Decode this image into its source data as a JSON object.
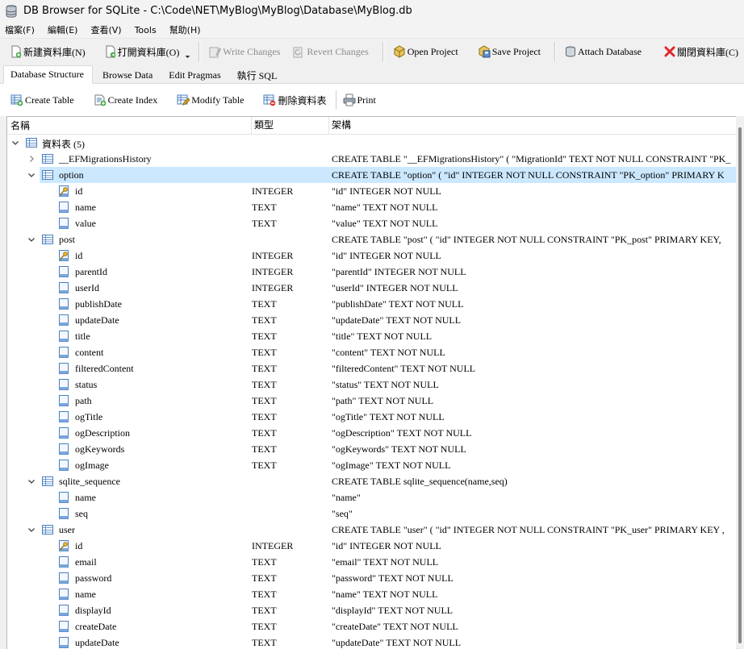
{
  "window": {
    "title": "DB Browser for SQLite - C:\\Code\\NET\\MyBlog\\MyBlog\\Database\\MyBlog.db",
    "icon": "database-app-icon"
  },
  "menu": [
    "檔案(F)",
    "編輯(E)",
    "查看(V)",
    "Tools",
    "幫助(H)"
  ],
  "toolbar": {
    "new_db": "新建資料庫(N)",
    "open_db": "打開資料庫(O)",
    "write_changes": "Write Changes",
    "revert_changes": "Revert Changes",
    "open_project": "Open Project",
    "save_project": "Save Project",
    "attach_db": "Attach Database",
    "close_db": "關閉資料庫(C)"
  },
  "tabs": [
    "Database Structure",
    "Browse Data",
    "Edit Pragmas",
    "執行 SQL"
  ],
  "active_tab": 0,
  "structure_toolbar": {
    "create_table": "Create Table",
    "create_index": "Create Index",
    "modify_table": "Modify Table",
    "delete_table": "刪除資料表",
    "print": "Print"
  },
  "columns": {
    "name": "名稱",
    "type": "類型",
    "schema": "架構"
  },
  "rows": [
    {
      "level": 0,
      "expander": "open",
      "icon": "table-group-icon",
      "name": "資料表 (5)",
      "type": "",
      "schema": ""
    },
    {
      "level": 1,
      "expander": "closed",
      "icon": "table-icon",
      "name": "__EFMigrationsHistory",
      "type": "",
      "schema": "CREATE TABLE \"__EFMigrationsHistory\" ( \"MigrationId\" TEXT NOT NULL CONSTRAINT \"PK_"
    },
    {
      "level": 1,
      "expander": "open",
      "icon": "table-icon",
      "name": "option",
      "type": "",
      "schema": "CREATE TABLE \"option\" ( \"id\" INTEGER NOT NULL CONSTRAINT \"PK_option\" PRIMARY K",
      "selected": true
    },
    {
      "level": 2,
      "icon": "key-field-icon",
      "name": "id",
      "type": "INTEGER",
      "schema": "\"id\" INTEGER NOT NULL"
    },
    {
      "level": 2,
      "icon": "field-icon",
      "name": "name",
      "type": "TEXT",
      "schema": "\"name\" TEXT NOT NULL"
    },
    {
      "level": 2,
      "icon": "field-icon",
      "name": "value",
      "type": "TEXT",
      "schema": "\"value\" TEXT NOT NULL"
    },
    {
      "level": 1,
      "expander": "open",
      "icon": "table-icon",
      "name": "post",
      "type": "",
      "schema": "CREATE TABLE \"post\" ( \"id\" INTEGER NOT NULL CONSTRAINT \"PK_post\" PRIMARY KEY,"
    },
    {
      "level": 2,
      "icon": "key-field-icon",
      "name": "id",
      "type": "INTEGER",
      "schema": "\"id\" INTEGER NOT NULL"
    },
    {
      "level": 2,
      "icon": "field-icon",
      "name": "parentId",
      "type": "INTEGER",
      "schema": "\"parentId\" INTEGER NOT NULL"
    },
    {
      "level": 2,
      "icon": "field-icon",
      "name": "userId",
      "type": "INTEGER",
      "schema": "\"userId\" INTEGER NOT NULL"
    },
    {
      "level": 2,
      "icon": "field-icon",
      "name": "publishDate",
      "type": "TEXT",
      "schema": "\"publishDate\" TEXT NOT NULL"
    },
    {
      "level": 2,
      "icon": "field-icon",
      "name": "updateDate",
      "type": "TEXT",
      "schema": "\"updateDate\" TEXT NOT NULL"
    },
    {
      "level": 2,
      "icon": "field-icon",
      "name": "title",
      "type": "TEXT",
      "schema": "\"title\" TEXT NOT NULL"
    },
    {
      "level": 2,
      "icon": "field-icon",
      "name": "content",
      "type": "TEXT",
      "schema": "\"content\" TEXT NOT NULL"
    },
    {
      "level": 2,
      "icon": "field-icon",
      "name": "filteredContent",
      "type": "TEXT",
      "schema": "\"filteredContent\" TEXT NOT NULL"
    },
    {
      "level": 2,
      "icon": "field-icon",
      "name": "status",
      "type": "TEXT",
      "schema": "\"status\" TEXT NOT NULL"
    },
    {
      "level": 2,
      "icon": "field-icon",
      "name": "path",
      "type": "TEXT",
      "schema": "\"path\" TEXT NOT NULL"
    },
    {
      "level": 2,
      "icon": "field-icon",
      "name": "ogTitle",
      "type": "TEXT",
      "schema": "\"ogTitle\" TEXT NOT NULL"
    },
    {
      "level": 2,
      "icon": "field-icon",
      "name": "ogDescription",
      "type": "TEXT",
      "schema": "\"ogDescription\" TEXT NOT NULL"
    },
    {
      "level": 2,
      "icon": "field-icon",
      "name": "ogKeywords",
      "type": "TEXT",
      "schema": "\"ogKeywords\" TEXT NOT NULL"
    },
    {
      "level": 2,
      "icon": "field-icon",
      "name": "ogImage",
      "type": "TEXT",
      "schema": "\"ogImage\" TEXT NOT NULL"
    },
    {
      "level": 1,
      "expander": "open",
      "icon": "table-icon",
      "name": "sqlite_sequence",
      "type": "",
      "schema": "CREATE TABLE sqlite_sequence(name,seq)"
    },
    {
      "level": 2,
      "icon": "field-icon",
      "name": "name",
      "type": "",
      "schema": "\"name\""
    },
    {
      "level": 2,
      "icon": "field-icon",
      "name": "seq",
      "type": "",
      "schema": "\"seq\""
    },
    {
      "level": 1,
      "expander": "open",
      "icon": "table-icon",
      "name": "user",
      "type": "",
      "schema": "CREATE TABLE \"user\" ( \"id\" INTEGER NOT NULL CONSTRAINT \"PK_user\" PRIMARY KEY ,"
    },
    {
      "level": 2,
      "icon": "key-field-icon",
      "name": "id",
      "type": "INTEGER",
      "schema": "\"id\" INTEGER NOT NULL"
    },
    {
      "level": 2,
      "icon": "field-icon",
      "name": "email",
      "type": "TEXT",
      "schema": "\"email\" TEXT NOT NULL"
    },
    {
      "level": 2,
      "icon": "field-icon",
      "name": "password",
      "type": "TEXT",
      "schema": "\"password\" TEXT NOT NULL"
    },
    {
      "level": 2,
      "icon": "field-icon",
      "name": "name",
      "type": "TEXT",
      "schema": "\"name\" TEXT NOT NULL"
    },
    {
      "level": 2,
      "icon": "field-icon",
      "name": "displayId",
      "type": "TEXT",
      "schema": "\"displayId\" TEXT NOT NULL"
    },
    {
      "level": 2,
      "icon": "field-icon",
      "name": "createDate",
      "type": "TEXT",
      "schema": "\"createDate\" TEXT NOT NULL"
    },
    {
      "level": 2,
      "icon": "field-icon",
      "name": "updateDate",
      "type": "TEXT",
      "schema": "\"updateDate\" TEXT NOT NULL"
    }
  ],
  "colors": {
    "selection": "#cce8ff",
    "icon_blue": "#4a7fc1"
  }
}
